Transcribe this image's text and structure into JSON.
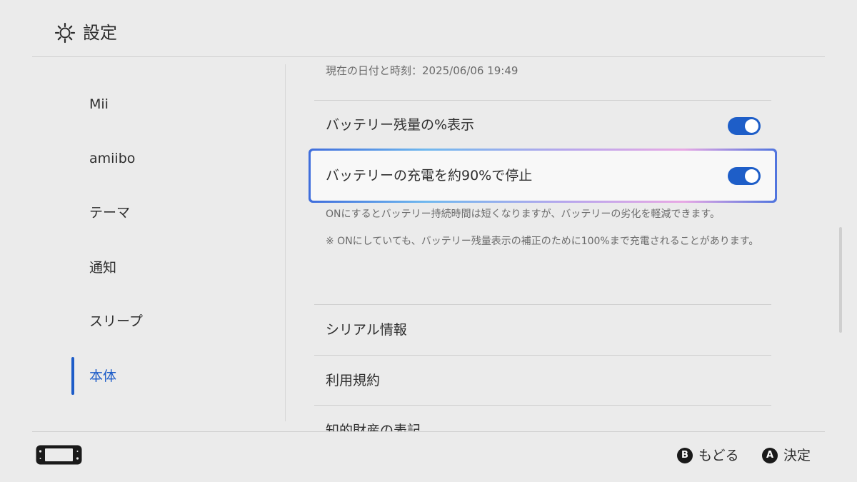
{
  "header": {
    "title": "設定",
    "icon": "gear-icon"
  },
  "sidebar": {
    "items": [
      {
        "label": "Mii"
      },
      {
        "label": "amiibo"
      },
      {
        "label": "テーマ"
      },
      {
        "label": "通知"
      },
      {
        "label": "スリープ"
      },
      {
        "label": "本体",
        "active": true
      }
    ]
  },
  "content": {
    "date_time": "現在の日付と時刻：2025/06/06 19:49",
    "battery_percent": {
      "label": "バッテリー残量の%表示",
      "on": true
    },
    "battery_limit": {
      "label": "バッテリーの充電を約90%で停止",
      "on": true,
      "focused": true
    },
    "note1": "ONにするとバッテリー持続時間は短くなりますが、バッテリーの劣化を軽減できます。",
    "note2": "※ ONにしていても、バッテリー残量表示の補正のために100%まで充電されることがあります。",
    "serial": "シリアル情報",
    "terms": "利用規約",
    "ip_notice": "知的財産の表記"
  },
  "footer": {
    "back": {
      "key": "B",
      "label": "もどる"
    },
    "confirm": {
      "key": "A",
      "label": "決定"
    }
  },
  "colors": {
    "accent": "#1e5ec8",
    "background": "#ebebeb",
    "text": "#2d2d2d",
    "muted": "#6a6a6a"
  }
}
